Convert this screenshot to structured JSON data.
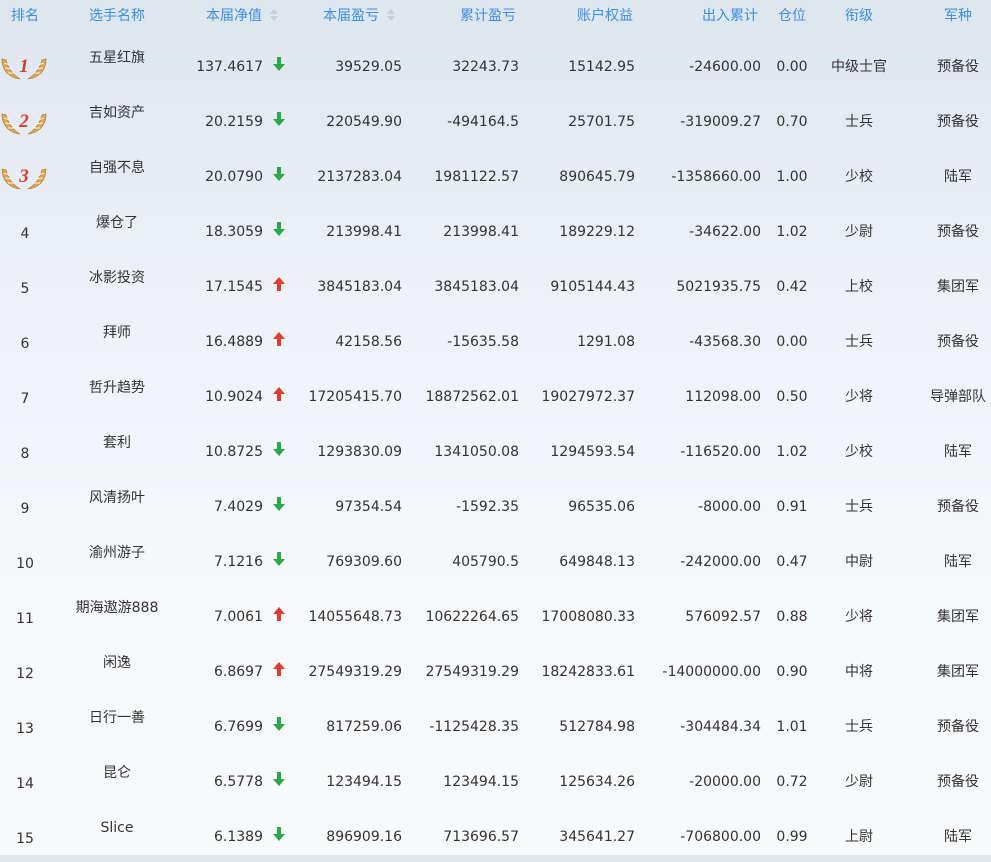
{
  "columns": {
    "rank": "排名",
    "name": "选手名称",
    "nav": "本届净值",
    "profit": "本届盈亏",
    "total": "累计盈亏",
    "equity": "账户权益",
    "flow": "出入累计",
    "position": "仓位",
    "title": "衔级",
    "army": "军种"
  },
  "colors": {
    "header_text": "#3d8fe0",
    "up": "#e03c31",
    "down": "#2aa84a",
    "medal_gold": "#d9a85a",
    "medal_num": "#d83a2c"
  },
  "rows": [
    {
      "rank": "1",
      "name": "五星红旗",
      "nav": "137.4617",
      "trend": "down",
      "profit": "39529.05",
      "total": "32243.73",
      "equity": "15142.95",
      "flow": "-24600.00",
      "position": "0.00",
      "title": "中级士官",
      "army": "预备役"
    },
    {
      "rank": "2",
      "name": "吉如资产",
      "nav": "20.2159",
      "trend": "down",
      "profit": "220549.90",
      "total": "-494164.5",
      "equity": "25701.75",
      "flow": "-319009.27",
      "position": "0.70",
      "title": "士兵",
      "army": "预备役"
    },
    {
      "rank": "3",
      "name": "自强不息",
      "nav": "20.0790",
      "trend": "down",
      "profit": "2137283.04",
      "total": "1981122.57",
      "equity": "890645.79",
      "flow": "-1358660.00",
      "position": "1.00",
      "title": "少校",
      "army": "陆军"
    },
    {
      "rank": "4",
      "name": "爆仓了",
      "nav": "18.3059",
      "trend": "down",
      "profit": "213998.41",
      "total": "213998.41",
      "equity": "189229.12",
      "flow": "-34622.00",
      "position": "1.02",
      "title": "少尉",
      "army": "预备役"
    },
    {
      "rank": "5",
      "name": "冰影投资",
      "nav": "17.1545",
      "trend": "up",
      "profit": "3845183.04",
      "total": "3845183.04",
      "equity": "9105144.43",
      "flow": "5021935.75",
      "position": "0.42",
      "title": "上校",
      "army": "集团军"
    },
    {
      "rank": "6",
      "name": "拜师",
      "nav": "16.4889",
      "trend": "up",
      "profit": "42158.56",
      "total": "-15635.58",
      "equity": "1291.08",
      "flow": "-43568.30",
      "position": "0.00",
      "title": "士兵",
      "army": "预备役"
    },
    {
      "rank": "7",
      "name": "哲升趋势",
      "nav": "10.9024",
      "trend": "up",
      "profit": "17205415.70",
      "total": "18872562.01",
      "equity": "19027972.37",
      "flow": "112098.00",
      "position": "0.50",
      "title": "少将",
      "army": "导弹部队"
    },
    {
      "rank": "8",
      "name": "套利",
      "nav": "10.8725",
      "trend": "down",
      "profit": "1293830.09",
      "total": "1341050.08",
      "equity": "1294593.54",
      "flow": "-116520.00",
      "position": "1.02",
      "title": "少校",
      "army": "陆军"
    },
    {
      "rank": "9",
      "name": "风清扬叶",
      "nav": "7.4029",
      "trend": "down",
      "profit": "97354.54",
      "total": "-1592.35",
      "equity": "96535.06",
      "flow": "-8000.00",
      "position": "0.91",
      "title": "士兵",
      "army": "预备役"
    },
    {
      "rank": "10",
      "name": "渝州游子",
      "nav": "7.1216",
      "trend": "down",
      "profit": "769309.60",
      "total": "405790.5",
      "equity": "649848.13",
      "flow": "-242000.00",
      "position": "0.47",
      "title": "中尉",
      "army": "陆军"
    },
    {
      "rank": "11",
      "name": "期海遨游888",
      "nav": "7.0061",
      "trend": "up",
      "profit": "14055648.73",
      "total": "10622264.65",
      "equity": "17008080.33",
      "flow": "576092.57",
      "position": "0.88",
      "title": "少将",
      "army": "集团军"
    },
    {
      "rank": "12",
      "name": "闲逸",
      "nav": "6.8697",
      "trend": "up",
      "profit": "27549319.29",
      "total": "27549319.29",
      "equity": "18242833.61",
      "flow": "-14000000.00",
      "position": "0.90",
      "title": "中将",
      "army": "集团军"
    },
    {
      "rank": "13",
      "name": "日行一善",
      "nav": "6.7699",
      "trend": "down",
      "profit": "817259.06",
      "total": "-1125428.35",
      "equity": "512784.98",
      "flow": "-304484.34",
      "position": "1.01",
      "title": "士兵",
      "army": "预备役"
    },
    {
      "rank": "14",
      "name": "昆仑",
      "nav": "6.5778",
      "trend": "down",
      "profit": "123494.15",
      "total": "123494.15",
      "equity": "125634.26",
      "flow": "-20000.00",
      "position": "0.72",
      "title": "少尉",
      "army": "预备役"
    },
    {
      "rank": "15",
      "name": "Slice",
      "nav": "6.1389",
      "trend": "down",
      "profit": "896909.16",
      "total": "713696.57",
      "equity": "345641.27",
      "flow": "-706800.00",
      "position": "0.99",
      "title": "上尉",
      "army": "陆军"
    }
  ]
}
